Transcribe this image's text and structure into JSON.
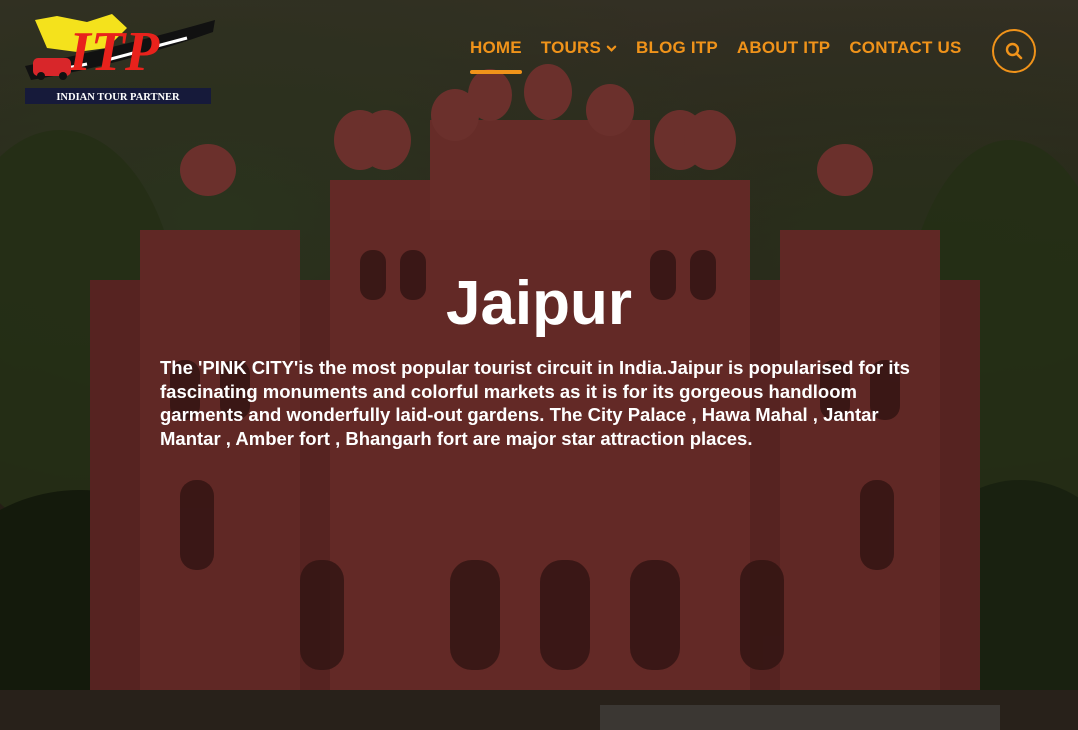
{
  "brand": {
    "logo_text": "ITP",
    "tagline": "INDIAN TOUR PARTNER"
  },
  "nav": {
    "items": [
      {
        "label": "HOME",
        "active": true
      },
      {
        "label": "TOURS",
        "has_dropdown": true
      },
      {
        "label": "BLOG ITP"
      },
      {
        "label": "ABOUT ITP"
      },
      {
        "label": "CONTACT US"
      }
    ],
    "search_icon": "search-icon"
  },
  "hero": {
    "title": "Jaipur",
    "description": "The 'PINK CITY'is the most popular tourist circuit in India.Jaipur is popularised for its fascinating monuments and colorful markets as it is for its gorgeous handloom garments and wonderfully laid-out gardens. The City Palace , Hawa Mahal , Jantar Mantar , Amber fort , Bhangarh fort are major star attraction places."
  },
  "colors": {
    "accent": "#f0931a",
    "text": "#ffffff",
    "logo_red": "#e8221c",
    "logo_yellow": "#f4e21c",
    "palace": "#8a3a35"
  }
}
